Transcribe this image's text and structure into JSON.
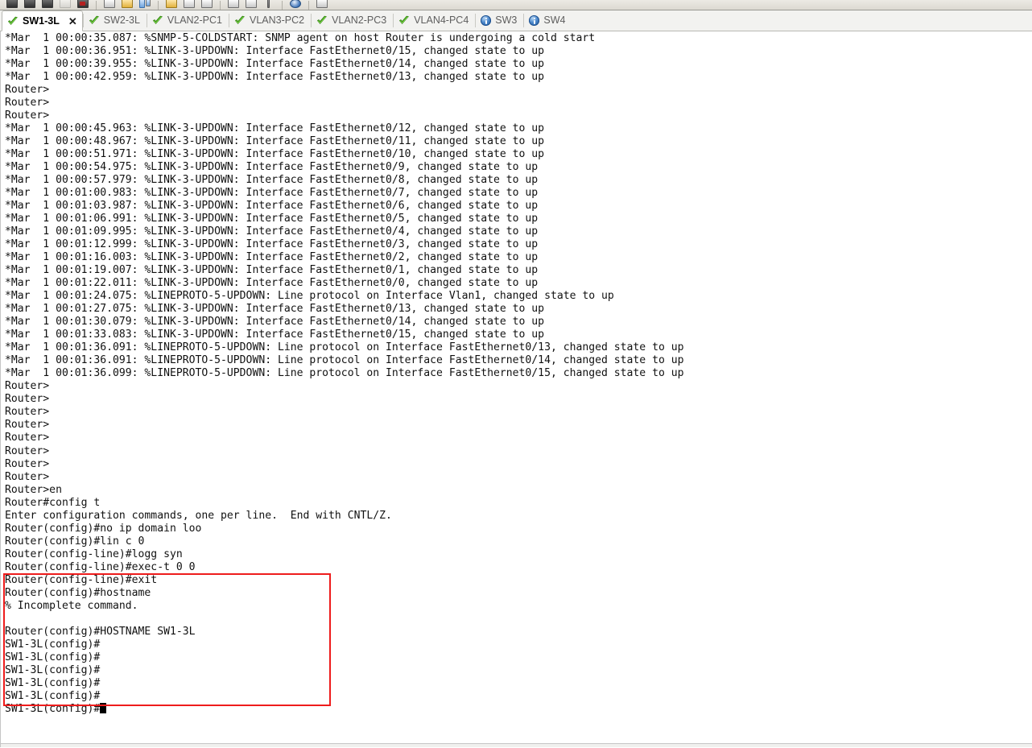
{
  "toolbar": {
    "icons": [
      "routers-icon",
      "routers-icon-2",
      "switches-icon",
      "hubs-icon",
      "devices-icon",
      "separator",
      "note-icon",
      "text-icon",
      "rectangle-icon",
      "separator",
      "open-file-icon",
      "open-file-icon-2",
      "open-file-icon-3",
      "separator",
      "pdu-icon",
      "scribble-icon",
      "marker-icon",
      "separator",
      "globe-icon",
      "separator",
      "panel-icon"
    ]
  },
  "tabs": {
    "items": [
      {
        "label": "SW1-3L",
        "icon": "green-check-icon",
        "active": true,
        "closable": true
      },
      {
        "label": "SW2-3L",
        "icon": "green-check-icon",
        "active": false,
        "closable": false
      },
      {
        "label": "VLAN2-PC1",
        "icon": "green-check-icon",
        "active": false,
        "closable": false
      },
      {
        "label": "VLAN3-PC2",
        "icon": "green-check-icon",
        "active": false,
        "closable": false
      },
      {
        "label": "VLAN2-PC3",
        "icon": "green-check-icon",
        "active": false,
        "closable": false
      },
      {
        "label": "VLAN4-PC4",
        "icon": "green-check-icon",
        "active": false,
        "closable": false
      },
      {
        "label": "SW3",
        "icon": "blue-info-icon",
        "active": false,
        "closable": false
      },
      {
        "label": "SW4",
        "icon": "blue-info-icon",
        "active": false,
        "closable": false
      }
    ],
    "close_glyph": "✕"
  },
  "annotation": {
    "color": "#ee1c1c",
    "shape": "rectangle",
    "label": "hostname-command-highlight"
  },
  "terminal": {
    "cursor": "block",
    "lines": [
      "*Mar  1 00:00:35.087: %SNMP-5-COLDSTART: SNMP agent on host Router is undergoing a cold start",
      "*Mar  1 00:00:36.951: %LINK-3-UPDOWN: Interface FastEthernet0/15, changed state to up",
      "*Mar  1 00:00:39.955: %LINK-3-UPDOWN: Interface FastEthernet0/14, changed state to up",
      "*Mar  1 00:00:42.959: %LINK-3-UPDOWN: Interface FastEthernet0/13, changed state to up",
      "Router>",
      "Router>",
      "Router>",
      "*Mar  1 00:00:45.963: %LINK-3-UPDOWN: Interface FastEthernet0/12, changed state to up",
      "*Mar  1 00:00:48.967: %LINK-3-UPDOWN: Interface FastEthernet0/11, changed state to up",
      "*Mar  1 00:00:51.971: %LINK-3-UPDOWN: Interface FastEthernet0/10, changed state to up",
      "*Mar  1 00:00:54.975: %LINK-3-UPDOWN: Interface FastEthernet0/9, changed state to up",
      "*Mar  1 00:00:57.979: %LINK-3-UPDOWN: Interface FastEthernet0/8, changed state to up",
      "*Mar  1 00:01:00.983: %LINK-3-UPDOWN: Interface FastEthernet0/7, changed state to up",
      "*Mar  1 00:01:03.987: %LINK-3-UPDOWN: Interface FastEthernet0/6, changed state to up",
      "*Mar  1 00:01:06.991: %LINK-3-UPDOWN: Interface FastEthernet0/5, changed state to up",
      "*Mar  1 00:01:09.995: %LINK-3-UPDOWN: Interface FastEthernet0/4, changed state to up",
      "*Mar  1 00:01:12.999: %LINK-3-UPDOWN: Interface FastEthernet0/3, changed state to up",
      "*Mar  1 00:01:16.003: %LINK-3-UPDOWN: Interface FastEthernet0/2, changed state to up",
      "*Mar  1 00:01:19.007: %LINK-3-UPDOWN: Interface FastEthernet0/1, changed state to up",
      "*Mar  1 00:01:22.011: %LINK-3-UPDOWN: Interface FastEthernet0/0, changed state to up",
      "*Mar  1 00:01:24.075: %LINEPROTO-5-UPDOWN: Line protocol on Interface Vlan1, changed state to up",
      "*Mar  1 00:01:27.075: %LINK-3-UPDOWN: Interface FastEthernet0/13, changed state to up",
      "*Mar  1 00:01:30.079: %LINK-3-UPDOWN: Interface FastEthernet0/14, changed state to up",
      "*Mar  1 00:01:33.083: %LINK-3-UPDOWN: Interface FastEthernet0/15, changed state to up",
      "*Mar  1 00:01:36.091: %LINEPROTO-5-UPDOWN: Line protocol on Interface FastEthernet0/13, changed state to up",
      "*Mar  1 00:01:36.091: %LINEPROTO-5-UPDOWN: Line protocol on Interface FastEthernet0/14, changed state to up",
      "*Mar  1 00:01:36.099: %LINEPROTO-5-UPDOWN: Line protocol on Interface FastEthernet0/15, changed state to up",
      "Router>",
      "Router>",
      "Router>",
      "Router>",
      "Router>",
      "Router>",
      "Router>",
      "Router>",
      "Router>en",
      "Router#config t",
      "Enter configuration commands, one per line.  End with CNTL/Z.",
      "Router(config)#no ip domain loo",
      "Router(config)#lin c 0",
      "Router(config-line)#logg syn",
      "Router(config-line)#exec-t 0 0",
      "Router(config-line)#exit",
      "Router(config)#hostname",
      "% Incomplete command.",
      "",
      "Router(config)#HOSTNAME SW1-3L",
      "SW1-3L(config)#",
      "SW1-3L(config)#",
      "SW1-3L(config)#",
      "SW1-3L(config)#",
      "SW1-3L(config)#",
      "SW1-3L(config)#"
    ]
  }
}
